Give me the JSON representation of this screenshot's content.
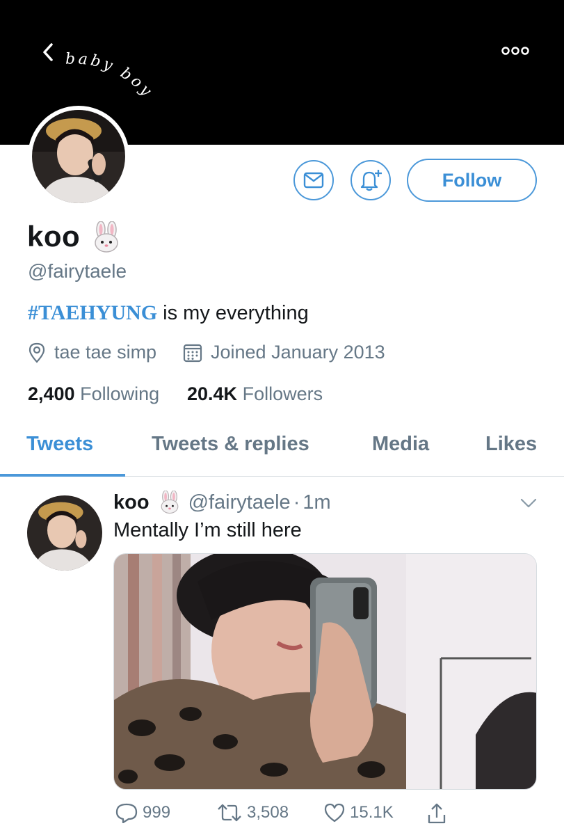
{
  "header": {
    "banner_text": "baby boy",
    "back_icon": "chevron-left-icon",
    "more_icon": "more-icon"
  },
  "profile": {
    "name": "koo",
    "name_emoji": "rabbit-face-icon",
    "handle": "@fairytaele",
    "bio_hashtag": "#TAEHYUNG",
    "bio_rest": " is my everything",
    "location": "tae tae simp",
    "joined": "Joined January 2013",
    "following_count": "2,400",
    "following_label": "Following",
    "followers_count": "20.4K",
    "followers_label": "Followers"
  },
  "actions": {
    "follow_label": "Follow",
    "message_icon": "envelope-icon",
    "notify_icon": "bell-plus-icon"
  },
  "tabs": [
    {
      "label": "Tweets",
      "active": true
    },
    {
      "label": "Tweets & replies",
      "active": false
    },
    {
      "label": "Media",
      "active": false
    },
    {
      "label": "Likes",
      "active": false
    }
  ],
  "tweet": {
    "name": "koo",
    "handle": "@fairytaele",
    "separator": "·",
    "time": "1m",
    "text": "Mentally I’m still here",
    "replies": "999",
    "retweets": "3,508",
    "likes": "15.1K"
  },
  "colors": {
    "accent": "#4b98d9",
    "banner": "#000000",
    "muted": "#657786"
  }
}
